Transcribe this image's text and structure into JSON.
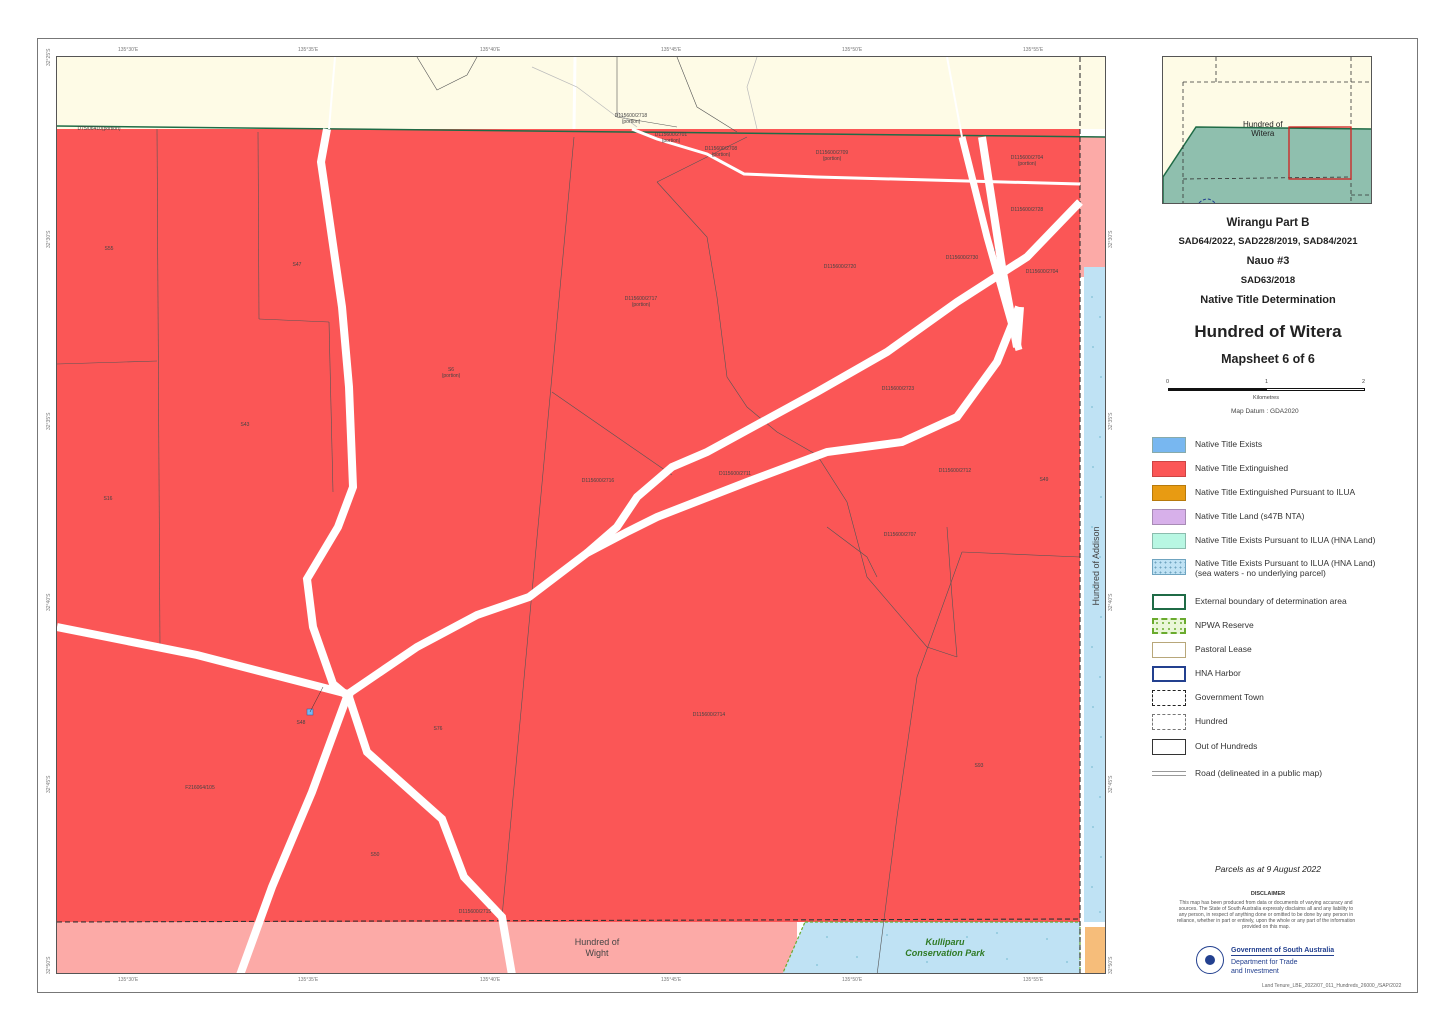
{
  "header": {
    "title1": "Wirangu Part B",
    "title2": "SAD64/2022, SAD228/2019, SAD84/2021",
    "title3": "Nauo #3",
    "title4": "SAD63/2018",
    "title5": "Native Title Determination",
    "main_title": "Hundred of Witera",
    "subtitle": "Mapsheet 6 of 6"
  },
  "inset": {
    "label": "Hundred of\nWitera"
  },
  "scale": {
    "tick0": "0",
    "tick1": "1",
    "tick2": "2",
    "unit": "Kilometres",
    "datum": "Map Datum : GDA2020"
  },
  "legend": [
    {
      "label": "Native Title Exists",
      "color": "#78b7f0",
      "style": "fill"
    },
    {
      "label": "Native Title Extinguished",
      "color": "#fb5656",
      "style": "fill"
    },
    {
      "label": "Native Title Extinguished Pursuant to ILUA",
      "color": "#e89b12",
      "style": "fill"
    },
    {
      "label": "Native Title Land (s47B NTA)",
      "color": "#d7b0ea",
      "style": "fill"
    },
    {
      "label": "Native Title Exists Pursuant to ILUA (HNA Land)",
      "color": "#b8f7e3",
      "style": "fill"
    },
    {
      "label": "Native Title Exists Pursuant to ILUA (HNA Land)\n(sea waters - no underlying parcel)",
      "color": "#bfe2f4",
      "style": "dots"
    },
    {
      "label": "External boundary of determination area",
      "color": "#1f6b46",
      "style": "outline"
    },
    {
      "label": "NPWA Reserve",
      "color": "#6aab2e",
      "style": "npwa"
    },
    {
      "label": "Pastoral Lease",
      "color": "#b8a77a",
      "style": "outline"
    },
    {
      "label": "HNA Harbor",
      "color": "#23408f",
      "style": "outline"
    },
    {
      "label": "Government Town",
      "color": "#222222",
      "style": "dash"
    },
    {
      "label": "Hundred",
      "color": "#555555",
      "style": "dash2"
    },
    {
      "label": "Out of Hundreds",
      "color": "#333333",
      "style": "outline"
    },
    {
      "label": "Road (delineated in a public map)",
      "color": "#999999",
      "style": "road"
    }
  ],
  "footer": {
    "parcels_date": "Parcels as at 9 August 2022",
    "disclaimer_title": "DISCLAIMER",
    "disclaimer": "This map has been produced from data or documents of varying accuracy and sources. The State of South Australia expressly disclaims all and any liability to any person, in respect of anything done or omitted to be done by any person in reliance, whether in part or entirely, upon the whole or any part of the information provided on this map.",
    "agency1": "Government of South Australia",
    "agency2": "Department for Trade",
    "agency3": "and Investment",
    "file_ref": "Land Tenure_LBE_2022/07_011_Hundreds_26000_/SAP/2022"
  },
  "map_labels": {
    "hundred_wight": "Hundred of\nWight",
    "hundred_addison": "Hundred of Addison",
    "kulliparu": "Kulliparu\nConservation Park",
    "parcels": [
      {
        "text": "D75/06410(portion)"
      },
      {
        "text": "D115600/2718\n(portion)"
      },
      {
        "text": "D115600/2701\n(portion)"
      },
      {
        "text": "D115600/2708\n(portion)"
      },
      {
        "text": "D115600/2709\n(portion)"
      },
      {
        "text": "D115600/2704\n(portion)"
      },
      {
        "text": "D115600/2728"
      },
      {
        "text": "S55"
      },
      {
        "text": "S47"
      },
      {
        "text": "D115600/2720"
      },
      {
        "text": "D115600/2730"
      },
      {
        "text": "D115600/2704"
      },
      {
        "text": "D115600/2717\n(portion)"
      },
      {
        "text": "S6\n(portion)"
      },
      {
        "text": "D115600/2723"
      },
      {
        "text": "S43"
      },
      {
        "text": "S16"
      },
      {
        "text": "D115600/2716"
      },
      {
        "text": "D115600/2711"
      },
      {
        "text": "D115600/2712"
      },
      {
        "text": "S49"
      },
      {
        "text": "D115600/2707"
      },
      {
        "text": "S48"
      },
      {
        "text": "S76"
      },
      {
        "text": "D115600/2714"
      },
      {
        "text": "F216064/105"
      },
      {
        "text": "S93"
      },
      {
        "text": "S50"
      },
      {
        "text": "D115600/2715"
      }
    ]
  },
  "ticks_top": [
    "135°30'E",
    "135°35'E",
    "135°40'E",
    "135°45'E",
    "135°50'E",
    "135°55'E"
  ],
  "ticks_bottom": [
    "135°30'E",
    "135°35'E",
    "135°40'E",
    "135°45'E",
    "135°50'E",
    "135°55'E"
  ],
  "ticks_left": [
    "32°25'S",
    "32°30'S",
    "32°35'S",
    "32°40'S",
    "32°45'S",
    "32°50'S"
  ],
  "ticks_right": [
    "32°30'S",
    "32°35'S",
    "32°40'S",
    "32°45'S",
    "32°50'S"
  ]
}
